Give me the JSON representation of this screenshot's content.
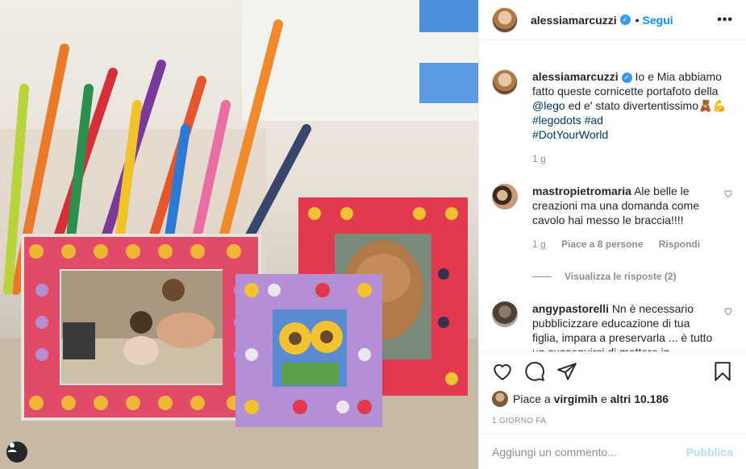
{
  "post": {
    "username": "alessiamarcuzzi",
    "follow_label": "Segui",
    "more_label": "•••",
    "dot": "•"
  },
  "caption": {
    "username": "alessiamarcuzzi",
    "text_1": "Io e Mia abbiamo fatto queste cornicette portafoto della ",
    "mention": "@lego",
    "text_2": " ed e' stato divertentissimo🧸💪",
    "tag_1": "#legodots",
    "tag_2": "#ad",
    "tag_3": "#DotYourWorld",
    "time": "1 g"
  },
  "comments": [
    {
      "username": "mastropietromaria",
      "text": "Ale belle le creazioni ma una domanda come cavolo hai messo le braccia!!!!",
      "time": "1 g",
      "likes": "Piace a 8 persone",
      "reply": "Rispondi",
      "view_replies": "Visualizza le risposte (2)"
    },
    {
      "username": "angypastorelli",
      "text": "Nn è necessario pubblicizzare educazione di tua figlia, impara a preservarla ... è tutto un susseguirsi di mettere in"
    }
  ],
  "likes": {
    "prefix": "Piace a ",
    "user": "virgimih",
    "mid": " e ",
    "others": "altri 10.186"
  },
  "date": "1 GIORNO FA",
  "add_comment": {
    "placeholder": "Aggiungi un commento...",
    "publish": "Pubblica"
  },
  "colors": {
    "accent": "#0095f6",
    "link": "#00376b",
    "muted": "#8e8e8e"
  }
}
